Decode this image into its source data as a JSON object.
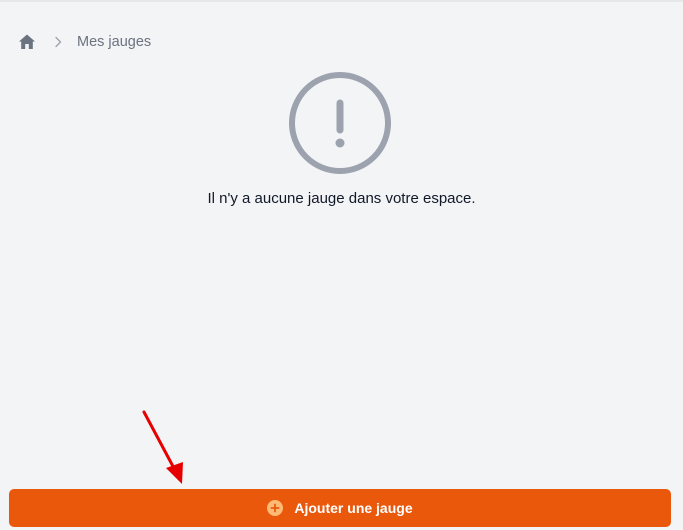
{
  "breadcrumb": {
    "home_icon": "home-icon",
    "separator_icon": "chevron-right-icon",
    "current": "Mes jauges"
  },
  "empty_state": {
    "icon": "exclamation-circle-icon",
    "message": "Il n'y a aucune jauge dans votre espace."
  },
  "actions": {
    "add_label": "Ajouter une jauge",
    "add_icon": "plus-circle-icon"
  },
  "colors": {
    "background": "#f3f4f6",
    "accent": "#ea580c",
    "icon_gray": "#9ca3af",
    "annotation_red": "#e60000"
  }
}
